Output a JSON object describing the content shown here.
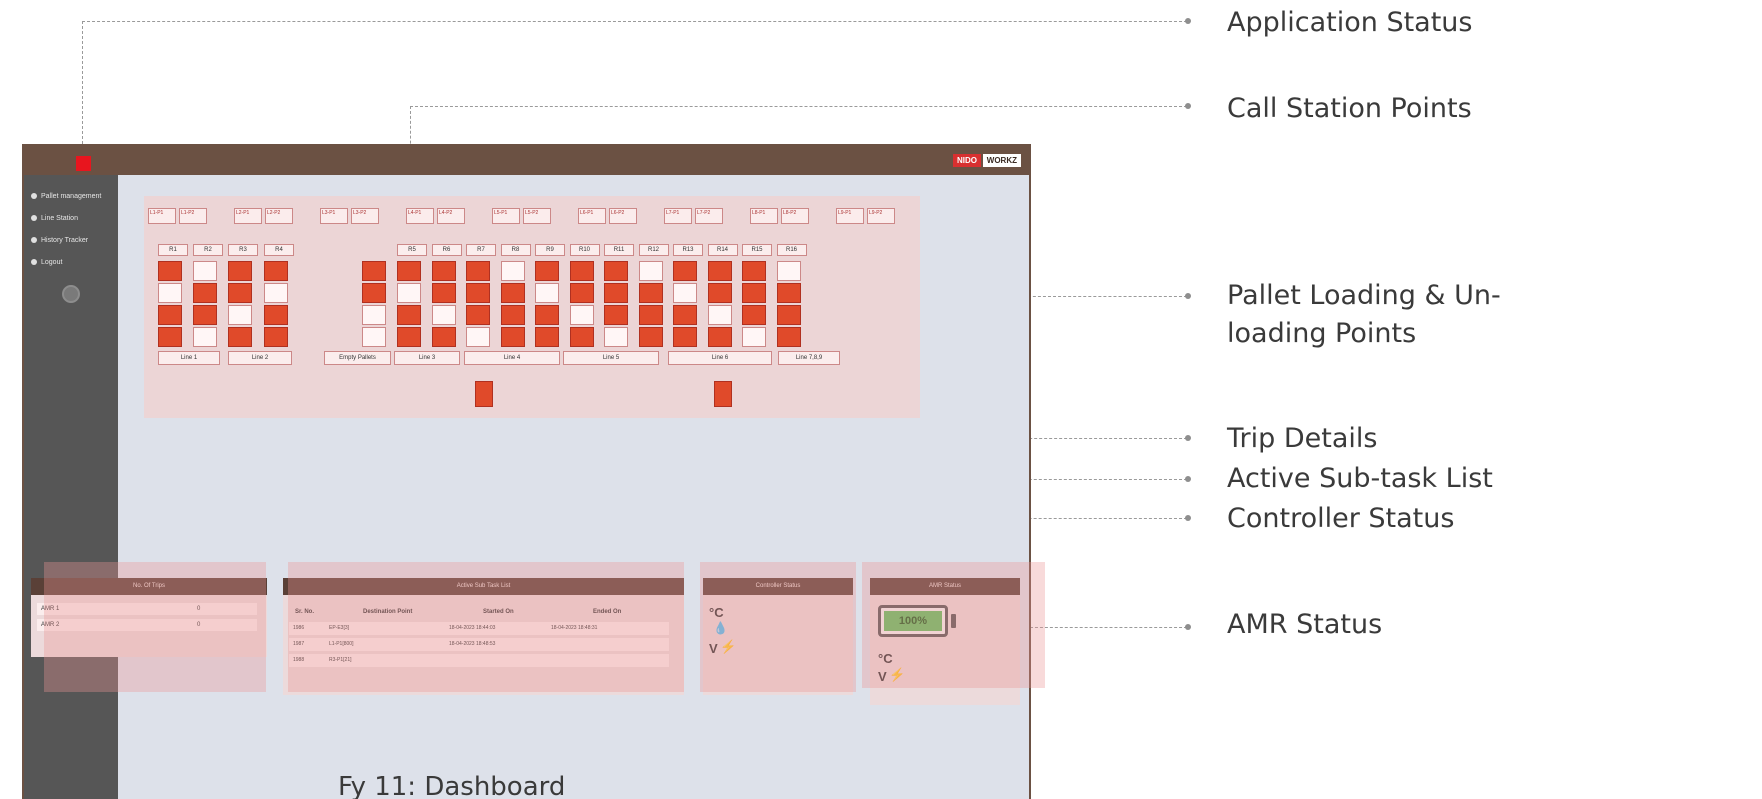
{
  "callouts": {
    "application_status": "Application Status",
    "call_station_points": "Call Station Points",
    "pallet_points_line1": "Pallet Loading & Un-",
    "pallet_points_line2": "loading Points",
    "trip_details": "Trip Details",
    "active_subtask_list": "Active Sub-task List",
    "controller_status": "Controller Status",
    "amr_status": "AMR Status"
  },
  "header": {
    "logo_nido": "NIDO",
    "logo_workz": "WORKZ",
    "status_color": "#e8151e"
  },
  "sidebar": {
    "items": [
      {
        "label": "Pallet management",
        "icon": "pallet-icon"
      },
      {
        "label": "Line Station",
        "icon": "station-icon"
      },
      {
        "label": "History Tracker",
        "icon": "history-icon"
      },
      {
        "label": "Logout",
        "icon": "logout-icon"
      }
    ]
  },
  "layout": {
    "station_groups": [
      [
        "L1-P1",
        "L1-P2"
      ],
      [
        "L2-P1",
        "L2-P2"
      ],
      [
        "L3-P1",
        "L3-P2"
      ],
      [
        "L4-P1",
        "L4-P2"
      ],
      [
        "L5-P1",
        "L5-P2"
      ],
      [
        "L6-P1",
        "L6-P2"
      ],
      [
        "L7-P1",
        "L7-P2"
      ],
      [
        "L8-P1",
        "L8-P2"
      ],
      [
        "L9-P1",
        "L9-P2"
      ]
    ],
    "col_heads_left": [
      "R1",
      "R2",
      "R3",
      "R4"
    ],
    "col_heads_right": [
      "R5",
      "R6",
      "R7",
      "R8",
      "R9",
      "R10",
      "R11",
      "R12",
      "R13",
      "R14",
      "R15",
      "R16"
    ],
    "lines": [
      "Line 1",
      "Line 2",
      "Empty Pallets",
      "Line 3",
      "Line 4",
      "Line 5",
      "Line 6",
      "Line 7,8,9"
    ]
  },
  "trips": {
    "header": "No. Of Trips",
    "rows": [
      {
        "name": "AMR 1",
        "value": "0"
      },
      {
        "name": "AMR 2",
        "value": "0"
      }
    ]
  },
  "subtasks": {
    "header": "Active Sub Task List",
    "columns": [
      "Sr. No.",
      "Destination Point",
      "Started On",
      "Ended On"
    ],
    "rows": [
      {
        "sr": "1986",
        "dest": "EP-E3[3]",
        "started": "18-04-2023 18:44:03",
        "ended": "18-04-2023 18:48:31"
      },
      {
        "sr": "1987",
        "dest": "L1-P1[800]",
        "started": "18-04-2023 18:48:53",
        "ended": ""
      },
      {
        "sr": "1988",
        "dest": "R3-P1[21]",
        "started": "",
        "ended": ""
      }
    ]
  },
  "controller": {
    "header": "Controller Status",
    "temp_unit": "°C",
    "voltage_unit": "V"
  },
  "amr": {
    "header": "AMR Status",
    "battery_percent": "100%",
    "battery_level": 1.0,
    "temp_unit": "°C",
    "voltage_unit": "V"
  },
  "caption": "Fy 11: Dashboard"
}
